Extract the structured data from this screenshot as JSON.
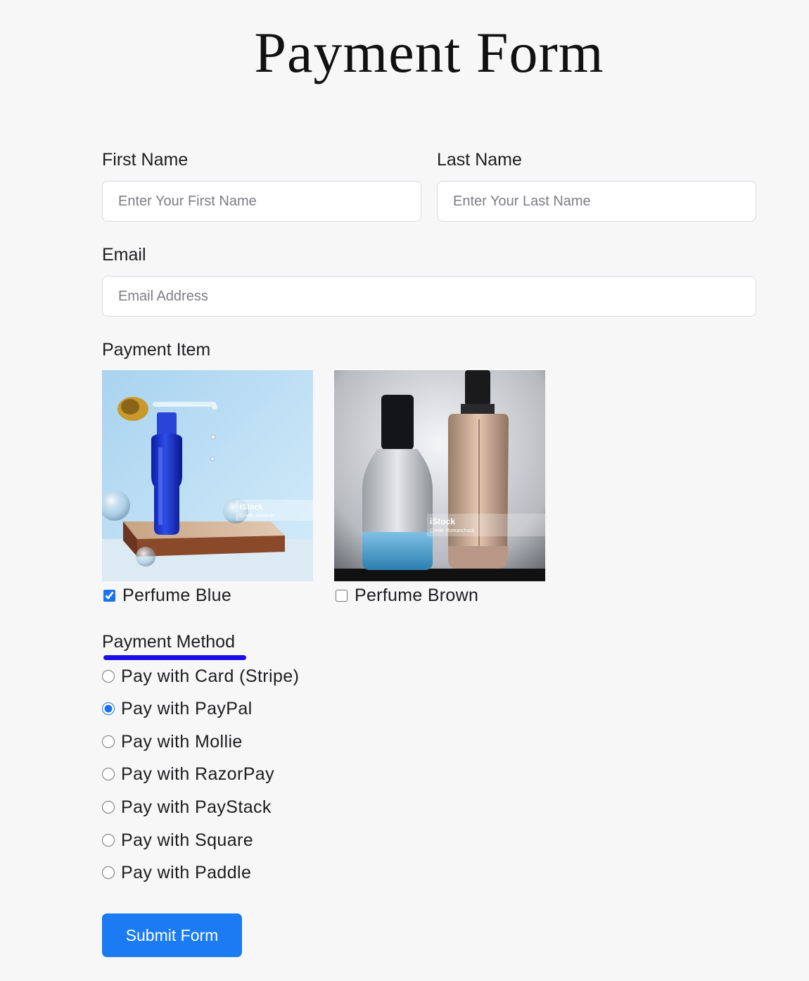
{
  "page": {
    "title": "Payment Form"
  },
  "form": {
    "first_name": {
      "label": "First Name",
      "placeholder": "Enter Your First Name",
      "value": ""
    },
    "last_name": {
      "label": "Last Name",
      "placeholder": "Enter Your Last Name",
      "value": ""
    },
    "email": {
      "label": "Email",
      "placeholder": "Email Address",
      "value": ""
    },
    "payment_item": {
      "label": "Payment Item",
      "items": [
        {
          "label": "Perfume Blue",
          "checked": true,
          "watermark": "iStock",
          "credit": "Credit: Akhilesh"
        },
        {
          "label": "Perfume Brown",
          "checked": false,
          "watermark": "iStock",
          "credit": "Credit: Romanchuck"
        }
      ]
    },
    "payment_method": {
      "label": "Payment Method",
      "underline_color": "#1a0ee8",
      "selected_index": 1,
      "options": [
        "Pay with Card (Stripe)",
        "Pay with PayPal",
        "Pay with Mollie",
        "Pay with RazorPay",
        "Pay with PayStack",
        "Pay with Square",
        "Pay with Paddle"
      ]
    },
    "submit_label": "Submit Form"
  },
  "colors": {
    "background": "#f7f7f8",
    "accent": "#1a7bf2",
    "input_border": "#d9dbe0"
  }
}
